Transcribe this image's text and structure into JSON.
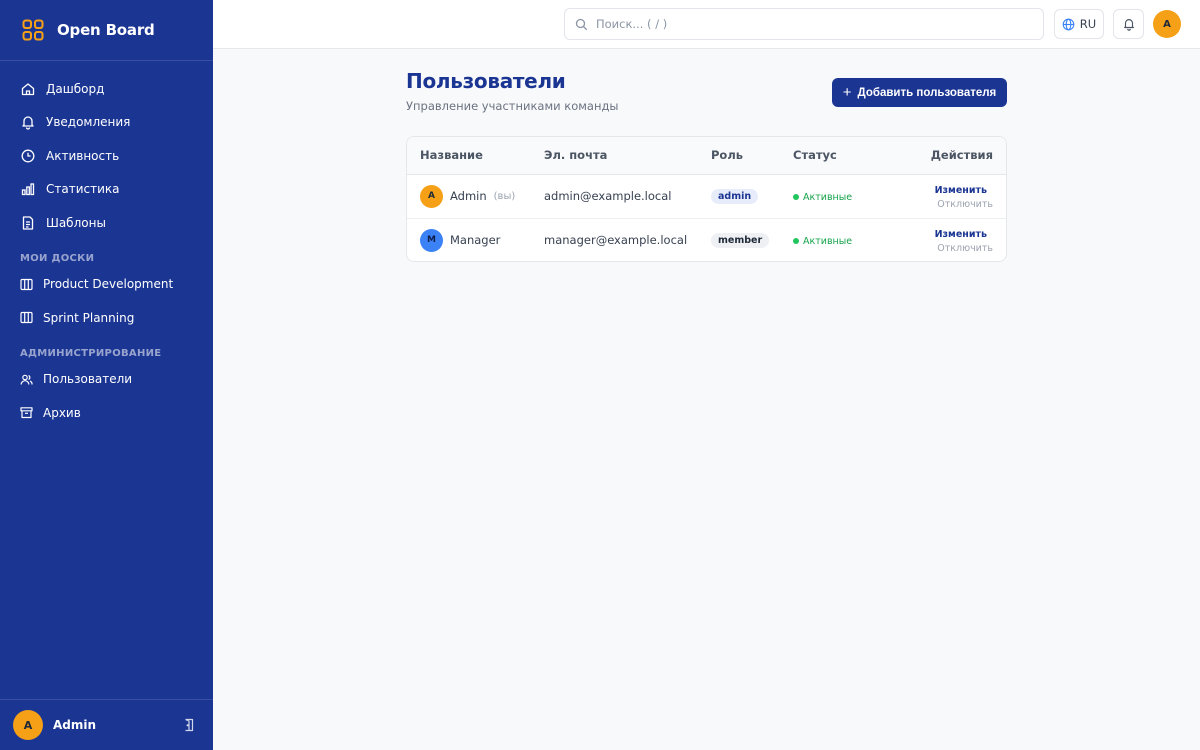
{
  "app": {
    "name": "Open Board"
  },
  "sidebar": {
    "items": [
      {
        "label": "Дашборд",
        "icon": "home-icon"
      },
      {
        "label": "Уведомления",
        "icon": "bell-icon"
      },
      {
        "label": "Активность",
        "icon": "clock-icon"
      },
      {
        "label": "Статистика",
        "icon": "bar-chart-icon"
      },
      {
        "label": "Шаблоны",
        "icon": "document-icon"
      }
    ],
    "boards_label": "Мои доски",
    "boards": [
      {
        "label": "Product Development",
        "icon": "board-icon"
      },
      {
        "label": "Sprint Planning",
        "icon": "board-icon"
      }
    ],
    "admin_label": "Администрирование",
    "admin_items": [
      {
        "label": "Пользователи",
        "icon": "users-icon"
      },
      {
        "label": "Архив",
        "icon": "archive-icon"
      }
    ],
    "footer": {
      "avatar": "A",
      "name": "Admin"
    }
  },
  "header": {
    "search_placeholder": "Поиск... ( / )",
    "language": "RU",
    "avatar": "A"
  },
  "main": {
    "title": "Пользователи",
    "subtitle": "Управление участниками команды",
    "add_button": "Добавить пользователя",
    "table": {
      "columns": [
        "Название",
        "Эл. почта",
        "Роль",
        "Статус",
        "Действия"
      ],
      "rows": [
        {
          "avatar": "A",
          "name": "Admin",
          "you": "(вы)",
          "email": "admin@example.local",
          "role": "admin",
          "status": "Активные",
          "edit": "Изменить",
          "disable": "Отключить"
        },
        {
          "avatar": "M",
          "name": "Manager",
          "you": "",
          "email": "manager@example.local",
          "role": "member",
          "status": "Активные",
          "edit": "Изменить",
          "disable": "Отключить"
        }
      ]
    }
  },
  "colors": {
    "sidebar": "#1b3593",
    "accent": "#1b3593",
    "avatar": "#f5a017",
    "active_status": "#16a34a"
  }
}
